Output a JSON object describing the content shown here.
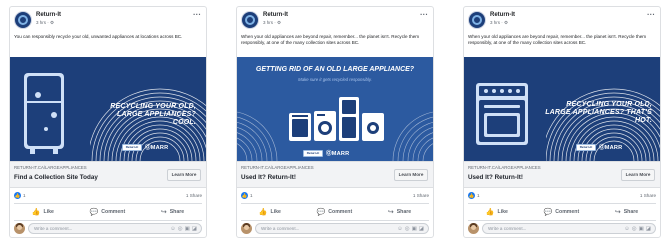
{
  "colors": {
    "brand_navy": "#1d3f7a",
    "illustration_blue": "#2c5aa0",
    "text_dark": "#1c1e21",
    "muted": "#606770",
    "like_blue": "#1877f2"
  },
  "cards": [
    {
      "page_name": "Return-It",
      "time": "3 hrs · ⚙",
      "body": "You can responsibly recycle your old, unwanted appliances at locations across BC.",
      "headline": "RECYCLING YOUR OLD, LARGE APPLIANCES? COOL.",
      "brand_badge": "Return-It",
      "brand_marr": "ⓄMARR",
      "domain": "RETURN-IT.CA/LARGEAPPLIANCES",
      "link_headline": "Find a Collection Site Today",
      "cta": "Learn More",
      "like_count": "1",
      "shares": "1 Share",
      "actions": {
        "like": "Like",
        "comment": "Comment",
        "share": "Share"
      },
      "comment_placeholder": "Write a comment..."
    },
    {
      "page_name": "Return-It",
      "time": "3 hrs · ⚙",
      "body": "When your old appliances are beyond repair, remember... the planet isn't. Recycle them responsibly, at one of the many collection sites across BC.",
      "headline": "GETTING RID OF AN OLD LARGE APPLIANCE?",
      "subheadline": "Make sure it gets recycled responsibly.",
      "brand_badge": "Return-It",
      "brand_marr": "ⓄMARR",
      "domain": "RETURN-IT.CA/LARGEAPPLIANCES",
      "link_headline": "Used It? Return-It!",
      "cta": "Learn More",
      "like_count": "1",
      "shares": "1 Share",
      "actions": {
        "like": "Like",
        "comment": "Comment",
        "share": "Share"
      },
      "comment_placeholder": "Write a comment..."
    },
    {
      "page_name": "Return-It",
      "time": "3 hrs · ⚙",
      "body": "When your old appliances are beyond repair, remember... the planet isn't. Recycle them responsibly, at one of the many collection sites across BC.",
      "headline": "RECYCLING YOUR OLD, LARGE APPLIANCES? THAT'S HOT.",
      "brand_badge": "Return-It",
      "brand_marr": "ⓄMARR",
      "domain": "RETURN-IT.CA/LARGEAPPLIANCES",
      "link_headline": "Used It? Return-It!",
      "cta": "Learn More",
      "like_count": "1",
      "shares": "1 Share",
      "actions": {
        "like": "Like",
        "comment": "Comment",
        "share": "Share"
      },
      "comment_placeholder": "Write a comment..."
    }
  ],
  "icons": {
    "like": "thumbs-up-icon",
    "comment": "speech-bubble-icon",
    "share": "share-arrow-icon",
    "more": "more-dots-icon"
  }
}
